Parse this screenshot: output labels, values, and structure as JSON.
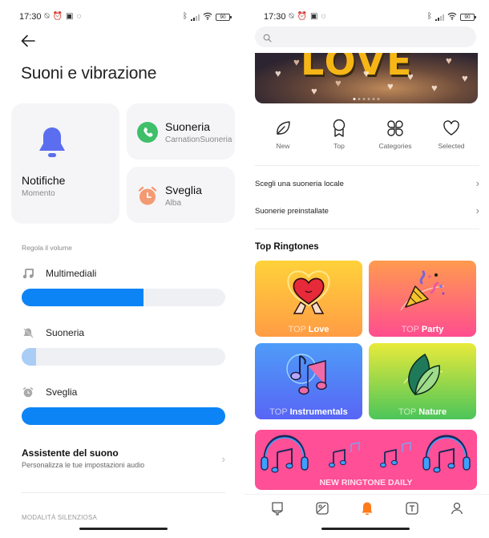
{
  "left_screen": {
    "status_bar": {
      "time": "17:30",
      "left_icons": [
        "vibrate-off-icon",
        "alarm-icon",
        "nfc-icon",
        "whatsapp-icon"
      ],
      "right_icons": [
        "bluetooth-icon",
        "signal-icon",
        "wifi-icon",
        "battery-icon"
      ],
      "battery": "90"
    },
    "title": "Suoni e vibrazione",
    "cards": {
      "notifiche": {
        "title": "Notifiche",
        "subtitle": "Momento",
        "icon": "bell-icon",
        "color": "#5b6ef0"
      },
      "suoneria": {
        "title": "Suoneria",
        "subtitle": "CarnationSuoneria",
        "icon": "phone-icon",
        "color": "#3fbf6a"
      },
      "sveglia": {
        "title": "Sveglia",
        "subtitle": "Alba",
        "icon": "alarm-clock-icon",
        "color": "#f49a72"
      }
    },
    "volume": {
      "section_label": "Regola il volume",
      "sliders": [
        {
          "label": "Multimediali",
          "icon": "music-note-icon",
          "level": 0.6,
          "muted": false
        },
        {
          "label": "Suoneria",
          "icon": "bell-off-icon",
          "level": 0.07,
          "muted": true
        },
        {
          "label": "Sveglia",
          "icon": "alarm-clock-icon",
          "level": 1.0,
          "muted": false
        }
      ]
    },
    "assistant": {
      "title": "Assistente del suono",
      "subtitle": "Personalizza le tue impostazioni audio"
    },
    "silent_mode_label": "MODALITÀ SILENZIOSA"
  },
  "right_screen": {
    "status_bar": {
      "time": "17:30",
      "battery": "90"
    },
    "search": {
      "placeholder": "",
      "value": ""
    },
    "banner": {
      "text": "LOVE",
      "dots": 6,
      "active_dot": 0
    },
    "categories": [
      {
        "label": "New",
        "icon": "leaf-icon"
      },
      {
        "label": "Top",
        "icon": "ribbon-award-icon"
      },
      {
        "label": "Categories",
        "icon": "grid-clover-icon"
      },
      {
        "label": "Selected",
        "icon": "heart-icon"
      }
    ],
    "list": [
      {
        "label": "Scegli una suoneria locale"
      },
      {
        "label": "Suonerie preinstallate"
      }
    ],
    "top_ringtones": {
      "title": "Top Ringtones",
      "prefix": "TOP",
      "tiles": [
        {
          "name": "Love"
        },
        {
          "name": "Party"
        },
        {
          "name": "Instrumentals"
        },
        {
          "name": "Nature"
        }
      ],
      "daily_label": "NEW RINGTONE DAILY"
    },
    "bottom_nav": [
      {
        "name": "wallpaper-icon",
        "active": false
      },
      {
        "name": "gallery-icon",
        "active": false
      },
      {
        "name": "ringtone-bell-icon",
        "active": true
      },
      {
        "name": "font-icon",
        "active": false
      },
      {
        "name": "profile-icon",
        "active": false
      }
    ],
    "accent_color": "#ff7a1a"
  }
}
